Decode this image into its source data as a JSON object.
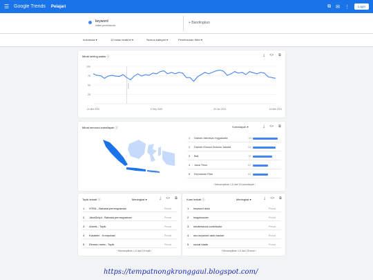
{
  "header": {
    "menu_icon": "menu-icon",
    "brand": "Google Trends",
    "tab": "Pelajari",
    "share_icon": "share-icon",
    "feedback_icon": "feedback-icon",
    "apps_icon": "apps-icon",
    "login": "Login"
  },
  "compare_bar": {
    "term": "keyword",
    "term_sub": "Istilah penelusuran",
    "compare": "+ Bandingkan"
  },
  "filters": {
    "location": "Indonesia",
    "time": "12 bulan terakhir",
    "category": "Semua kategori",
    "search_type": "Penelusuran Web"
  },
  "interest_card": {
    "title": "Minat seiring waktu"
  },
  "region_card": {
    "title": "Minat menurut subwilayah",
    "dropdown": "Subwilayah",
    "pager": "Menampilkan 1-5 dari 33 subwilayah",
    "rows": [
      {
        "rank": "1",
        "name": "Daerah Istimewa Yogyakarta",
        "score": "100",
        "pct": 100
      },
      {
        "rank": "2",
        "name": "Daerah Khusus Ibukota Jakarta",
        "score": "93",
        "pct": 93
      },
      {
        "rank": "3",
        "name": "Bali",
        "score": "78",
        "pct": 78
      },
      {
        "rank": "4",
        "name": "Jawa Timur",
        "score": "62",
        "pct": 62
      },
      {
        "rank": "5",
        "name": "Kepulauan Riau",
        "score": "62",
        "pct": 62
      }
    ]
  },
  "topic_card": {
    "title": "Topik terkait",
    "sort": "Meningkat",
    "pager": "Menampilkan 1-5 dari 15 topik",
    "rows": [
      {
        "rank": "1",
        "label": "HTML - Bahasa pemrograman",
        "value": "Pesat"
      },
      {
        "rank": "2",
        "label": "JavaScript - Bahasa pemrograman",
        "value": "Pesat"
      },
      {
        "rank": "3",
        "label": "Ahrefs - Topik",
        "value": "Pesat"
      },
      {
        "rank": "4",
        "label": "Karakter - Komputasi",
        "value": "Pesat"
      },
      {
        "rank": "5",
        "label": "Elemen meta - Topik",
        "value": "Pesat"
      }
    ]
  },
  "query_card": {
    "title": "Kueri terkait",
    "sort": "Meningkat",
    "pager": "Menampilkan 1-5 dari 25 kueri",
    "rows": [
      {
        "rank": "1",
        "label": "keyword dark",
        "value": "Pesat"
      },
      {
        "rank": "2",
        "label": "insgahooder",
        "value": "Pesat"
      },
      {
        "rank": "3",
        "label": "shutterstock contributor",
        "value": "Pesat"
      },
      {
        "rank": "4",
        "label": "seo keyword rank tracker",
        "value": "Pesat"
      },
      {
        "rank": "5",
        "label": "social blade",
        "value": "Pesat"
      }
    ]
  },
  "watermark": "https://tempatnongkronggaul.blogspot.com/",
  "colors": {
    "accent": "#1a73e8",
    "series": "#4285f4",
    "map_light": "#c6dafc",
    "map_dark": "#1a73e8"
  },
  "chart_data": {
    "type": "line",
    "title": "",
    "xlabel": "",
    "ylabel": "",
    "ylim": [
      0,
      100
    ],
    "y_ticks": [
      "100",
      "75",
      "50",
      "25"
    ],
    "x_ticks": [
      {
        "index": 0,
        "label": "14 Mei 2020"
      },
      {
        "index": 17,
        "label": "6 Sep 2020"
      },
      {
        "index": 34,
        "label": "30 Jan 2021"
      },
      {
        "index": 49,
        "label": "16 Mei 2021"
      }
    ],
    "annotation": {
      "index": 9,
      "label": "Catatan"
    },
    "series": [
      {
        "values": [
          80,
          76,
          75,
          68,
          74,
          76,
          74,
          73,
          78,
          70,
          64,
          74,
          80,
          74,
          78,
          76,
          82,
          80,
          86,
          88,
          80,
          84,
          80,
          84,
          82,
          70,
          70,
          60,
          72,
          78,
          84,
          80,
          84,
          88,
          90,
          87,
          76,
          80,
          86,
          82,
          84,
          78,
          86,
          83,
          80,
          84,
          82,
          72,
          70,
          68
        ]
      }
    ]
  }
}
